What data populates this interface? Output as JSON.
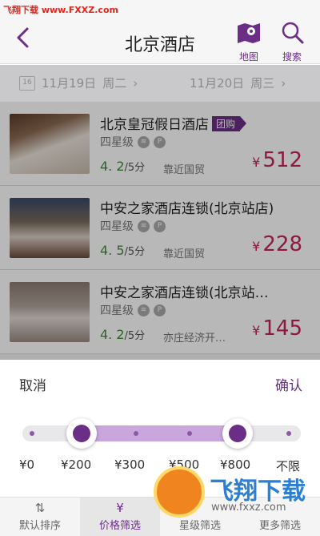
{
  "watermark_top": "飞翔下载 www.FXXZ.com",
  "navbar": {
    "title": "北京酒店",
    "map_label": "地图",
    "search_label": "搜索"
  },
  "datebar": {
    "checkin_date": "11月19日",
    "checkin_weekday": "周二",
    "checkout_date": "11月20日",
    "checkout_weekday": "周三",
    "calendar_day": "16"
  },
  "hotels": [
    {
      "name": "北京皇冠假日酒店",
      "badge": "团购",
      "star": "四星级",
      "score": "4. 2",
      "score_unit": "/5分",
      "area": "靠近国贸",
      "currency": "¥",
      "price": "512"
    },
    {
      "name": "中安之家酒店连锁(北京站店)",
      "badge": "",
      "star": "四星级",
      "score": "4. 5",
      "score_unit": "/5分",
      "area": "靠近国贸",
      "currency": "¥",
      "price": "228"
    },
    {
      "name": "中安之家酒店连锁(北京站…",
      "badge": "",
      "star": "四星级",
      "score": "4. 2",
      "score_unit": "/5分",
      "area": "亦庄经济开…",
      "currency": "¥",
      "price": "145"
    }
  ],
  "filter_panel": {
    "cancel_label": "取消",
    "confirm_label": "确认",
    "ticks": [
      "¥0",
      "¥200",
      "¥300",
      "¥500",
      "¥800",
      "不限"
    ],
    "selected_min": "¥200",
    "selected_max": "¥800"
  },
  "tabbar": [
    {
      "label": "默认排序",
      "glyph": "⇅",
      "active": false
    },
    {
      "label": "价格筛选",
      "glyph": "¥",
      "active": true
    },
    {
      "label": "星级筛选",
      "glyph": "",
      "active": false
    },
    {
      "label": "更多筛选",
      "glyph": "",
      "active": false
    }
  ],
  "watermark_logo": {
    "text": "飞翔下载",
    "url": "www.fxxz.com"
  },
  "colors": {
    "accent": "#6b2e86",
    "price": "#c4225a",
    "score": "#3d8c34",
    "range_fill": "#c9a6dc"
  }
}
